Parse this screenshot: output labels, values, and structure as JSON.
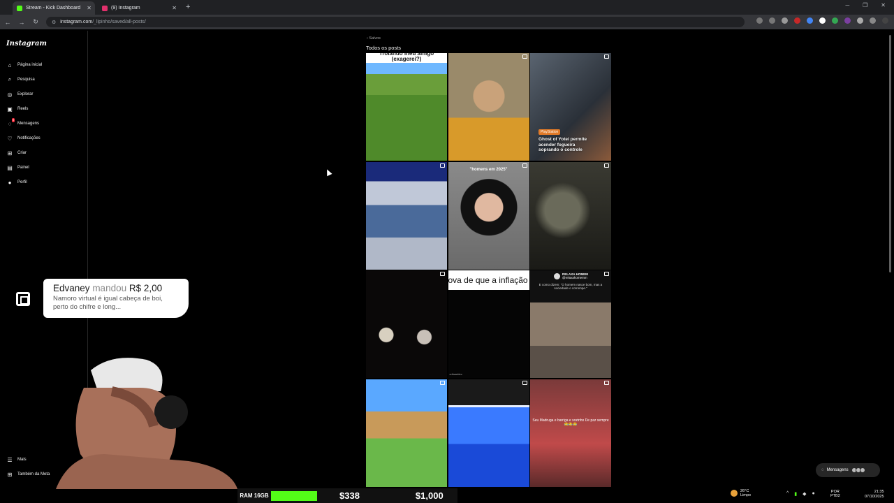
{
  "browser": {
    "tabs": [
      {
        "label": "Stream - Kick Dashboard",
        "favicon_color": "#53fc18",
        "active": true
      },
      {
        "label": "(9) Instagram",
        "favicon_color": "#e1306c",
        "active": false
      }
    ],
    "new_tab": "+",
    "url_host": "instagram.com",
    "url_path": "/_lipinho/saved/all-posts/"
  },
  "instagram": {
    "logo": "Instagram",
    "nav": [
      {
        "label": "Página inicial",
        "icon": "home-icon",
        "glyph": "⌂"
      },
      {
        "label": "Pesquisa",
        "icon": "search-icon",
        "glyph": "⌕"
      },
      {
        "label": "Explorar",
        "icon": "compass-icon",
        "glyph": "◎"
      },
      {
        "label": "Reels",
        "icon": "reels-icon",
        "glyph": "▣"
      },
      {
        "label": "Mensagens",
        "icon": "messenger-icon",
        "glyph": "◌",
        "badge": "9"
      },
      {
        "label": "Notificações",
        "icon": "heart-icon",
        "glyph": "♡"
      },
      {
        "label": "Criar",
        "icon": "create-icon",
        "glyph": "⊞"
      },
      {
        "label": "Painel",
        "icon": "dashboard-icon",
        "glyph": "▤"
      },
      {
        "label": "Perfil",
        "icon": "profile-icon",
        "glyph": "●"
      }
    ],
    "more": "Mais",
    "meta": "Também da Meta",
    "breadcrumb": "Salvos",
    "section_title": "Todos os posts",
    "posts": {
      "p1_caption": "Trolando meu amigo (exagerei?)",
      "p3_tag": "PlayStation",
      "p3_text": "Ghost of Yotei permite acender fogueira soprando o controle",
      "p5_caption": "\"homens em 2025\"",
      "p8_strip": "ova de que a inflação e",
      "p8_handle": "cribastdev",
      "p9_account": "RELAXA HOMEM",
      "p9_handle": "@relaxahomemm",
      "p9_tweet": "E como dizem: \"O homem nasce bom, mas a sociedade o corrompe.\"",
      "p12_caption": "Seu Madruga e barriga e sozinho De paz sempre 😂😂😂"
    },
    "messages_pill": "Mensagens",
    "messages_badge": "9"
  },
  "stream": {
    "donor": "Edvaney",
    "verb": "mandou",
    "amount": "R$ 2,00",
    "message": "Namoro virtual é igual cabeça de boi, perto do chifre e long...",
    "ram_label": "RAM 16GB",
    "goal1": "$338",
    "goal2": "$1,000"
  },
  "taskbar": {
    "temp": "26°C",
    "weather": "Limpo",
    "lang1": "POR",
    "lang2": "PTB2",
    "time": "21:35",
    "date": "07/10/2025"
  }
}
